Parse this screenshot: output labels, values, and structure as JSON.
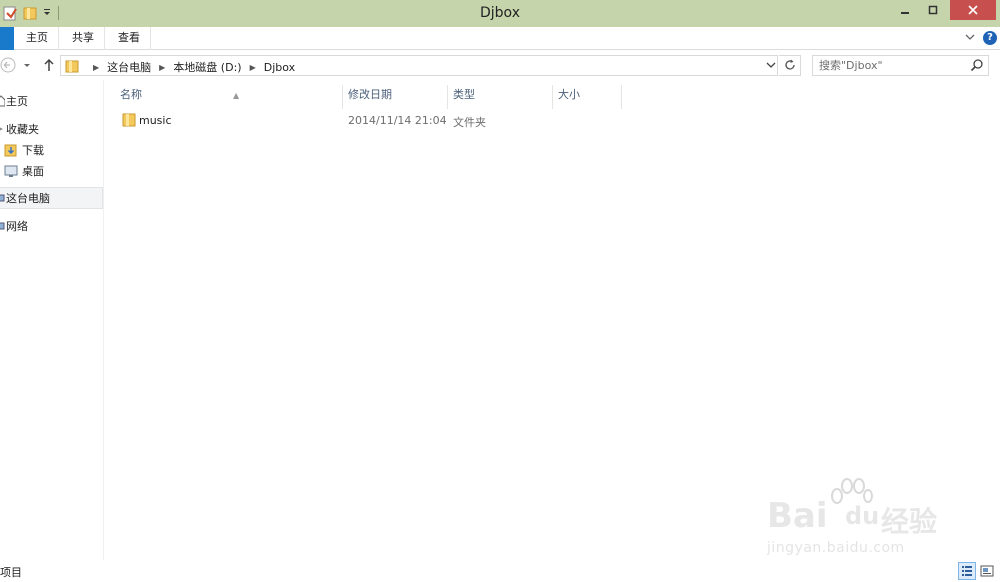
{
  "window": {
    "title": "Djbox"
  },
  "ribbon": {
    "tabs": [
      "主页",
      "共享",
      "查看"
    ]
  },
  "address": {
    "crumbs": [
      "这台电脑",
      "本地磁盘 (D:)",
      "Djbox"
    ]
  },
  "search": {
    "placeholder": "搜索\"Djbox\""
  },
  "nav": {
    "items": [
      {
        "label": "主页",
        "icon": "home-icon"
      },
      {
        "label": "收藏夹",
        "icon": "favorites-star-icon"
      },
      {
        "label": "下载",
        "icon": "downloads-folder-icon"
      },
      {
        "label": "桌面",
        "icon": "desktop-icon"
      },
      {
        "label": "这台电脑",
        "icon": "computer-icon",
        "selected": true
      },
      {
        "label": "网络",
        "icon": "network-icon"
      }
    ]
  },
  "list": {
    "columns": [
      "名称",
      "修改日期",
      "类型",
      "大小"
    ],
    "rows": [
      {
        "name": "music",
        "modified": "2014/11/14 21:04",
        "type": "文件夹",
        "size": ""
      }
    ]
  },
  "status": {
    "text": "项目"
  },
  "watermark": {
    "brand": "Bai",
    "brand2": "du",
    "cn": "经验",
    "url": "jingyan.baidu.com"
  },
  "colors": {
    "titlebar": "#c6d4ac",
    "close": "#c74f4d",
    "file_tab": "#1979ca",
    "column_header": "#4c607a"
  }
}
